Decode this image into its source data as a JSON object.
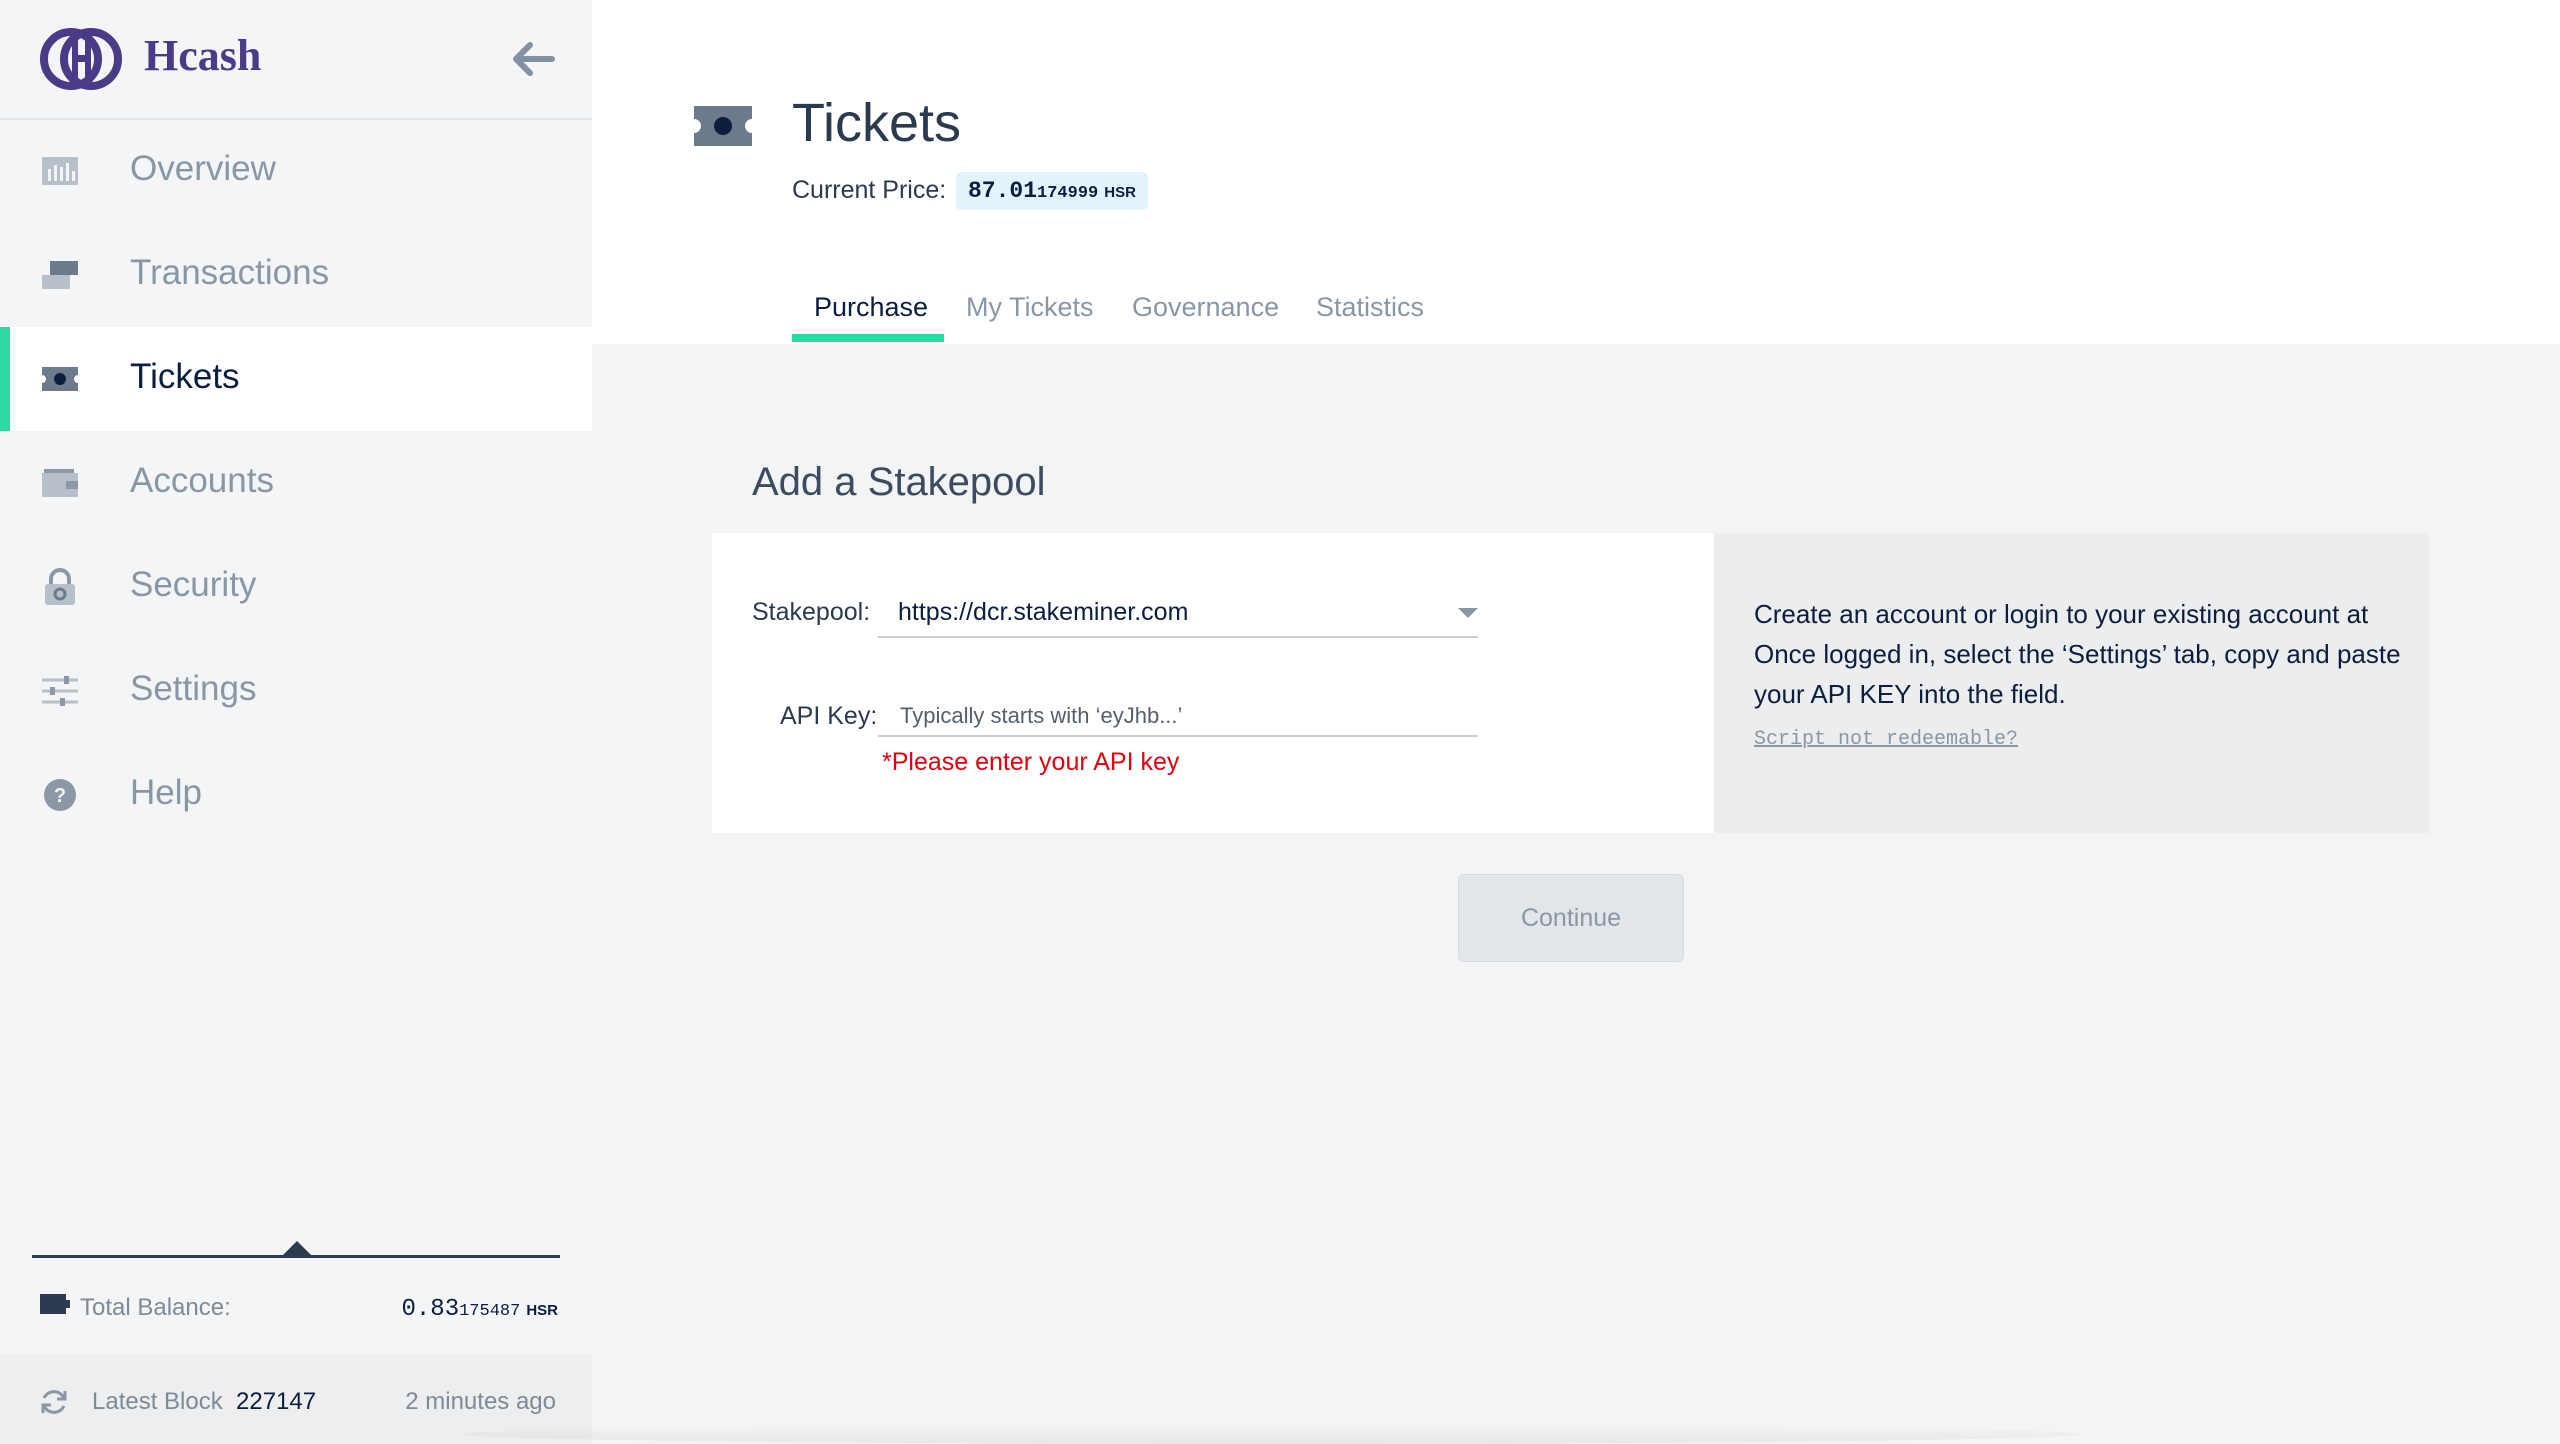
{
  "app": {
    "brand_name": "Hcash"
  },
  "sidebar": {
    "items": [
      {
        "label": "Overview",
        "icon": "overview-icon"
      },
      {
        "label": "Transactions",
        "icon": "transactions-icon"
      },
      {
        "label": "Tickets",
        "icon": "ticket-icon",
        "active": true
      },
      {
        "label": "Accounts",
        "icon": "wallet-icon"
      },
      {
        "label": "Security",
        "icon": "lock-icon"
      },
      {
        "label": "Settings",
        "icon": "sliders-icon"
      },
      {
        "label": "Help",
        "icon": "help-icon"
      }
    ],
    "balance": {
      "label": "Total Balance:",
      "amount_main": "0.83",
      "amount_small": "175487",
      "unit": "HSR"
    },
    "latest_block": {
      "label": "Latest Block",
      "number": "227147",
      "ago": "2 minutes ago"
    }
  },
  "header": {
    "title": "Tickets",
    "price_label": "Current Price:",
    "price_main": "87.01",
    "price_small": "174999",
    "price_unit": "HSR",
    "tabs": [
      {
        "label": "Purchase",
        "active": true
      },
      {
        "label": "My Tickets"
      },
      {
        "label": "Governance"
      },
      {
        "label": "Statistics"
      }
    ]
  },
  "stakepool": {
    "section_title": "Add a Stakepool",
    "stakepool_label": "Stakepool:",
    "stakepool_value": "https://dcr.stakeminer.com",
    "api_key_label": "API Key:",
    "api_key_placeholder": "Typically starts with ‘eyJhb...’",
    "api_key_error": "*Please enter your API key",
    "info_text": "Create an account or login to your existing account at Once logged in, select the ‘Settings’ tab, copy and paste your API KEY into the field.",
    "info_link": "Script not redeemable?",
    "continue_label": "Continue"
  },
  "colors": {
    "accent": "#2ed8a3",
    "brand": "#4a3a87",
    "error": "#e0000e",
    "text_dark": "#0c1e3e",
    "text_muted": "#8997a5"
  }
}
